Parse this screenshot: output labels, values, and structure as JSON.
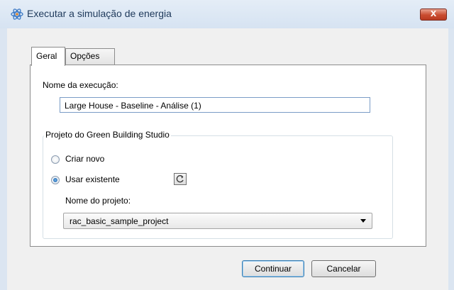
{
  "window": {
    "title": "Executar a simulação de energia",
    "close_label": "x",
    "icon": "energy-atom-icon"
  },
  "tabs": [
    {
      "label": "Geral",
      "active": true
    },
    {
      "label": "Opções",
      "active": false
    }
  ],
  "general": {
    "run_name_label": "Nome da execução:",
    "run_name_value": "Large House - Baseline - Análise (1)"
  },
  "project_group": {
    "legend": "Projeto do Green Building Studio",
    "create_new_label": "Criar novo",
    "use_existing_label": "Usar existente",
    "selected_option": "use_existing",
    "refresh_icon": "refresh-icon",
    "project_name_label": "Nome do projeto:",
    "project_name_value": "rac_basic_sample_project"
  },
  "buttons": {
    "continue_label": "Continuar",
    "cancel_label": "Cancelar"
  },
  "colors": {
    "titlebar": "#d6e3f2",
    "close_button": "#c94b2f",
    "dialog_background": "#f0f0f0",
    "textbox_border": "#7a9cc6"
  }
}
